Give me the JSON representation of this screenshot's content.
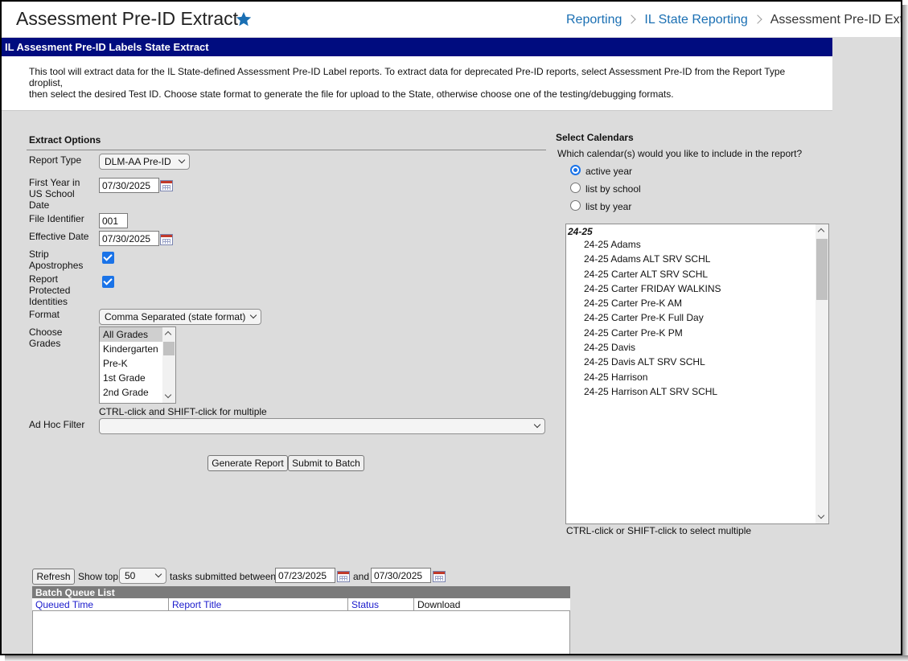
{
  "header": {
    "title": "Assessment Pre-ID Extract",
    "breadcrumb": [
      "Reporting",
      "IL State Reporting",
      "Assessment Pre-ID Extract"
    ]
  },
  "banner": {
    "title": "IL Assesment Pre-ID Labels State Extract"
  },
  "description": {
    "line1": "This tool will extract data for the IL State-defined Assessment Pre-ID Label reports. To extract data for deprecated Pre-ID reports, select Assessment Pre-ID from the Report Type droplist,",
    "line2": "then select the desired Test ID. Choose state format to generate the file for upload to the State, otherwise choose one of the testing/debugging formats."
  },
  "extract_options": {
    "title": "Extract Options",
    "report_type": {
      "label": "Report Type",
      "value": "DLM-AA Pre-ID"
    },
    "first_year": {
      "label": "First Year in US School Date",
      "value": "07/30/2025"
    },
    "file_identifier": {
      "label": "File Identifier",
      "value": "001"
    },
    "effective_date": {
      "label": "Effective Date",
      "value": "07/30/2025"
    },
    "strip_apostrophes": {
      "label": "Strip Apostrophes",
      "checked": true
    },
    "report_protected": {
      "label": "Report Protected Identities",
      "checked": true
    },
    "format": {
      "label": "Format",
      "value": "Comma Separated (state format)"
    },
    "grades": {
      "label": "Choose Grades",
      "items": [
        "All Grades",
        "Kindergarten",
        "Pre-K",
        "1st Grade",
        "2nd Grade"
      ],
      "selected": "All Grades",
      "hint": "CTRL-click and SHIFT-click for multiple"
    },
    "ad_hoc": {
      "label": "Ad Hoc Filter",
      "value": ""
    },
    "generate_label": "Generate Report",
    "submit_label": "Submit to Batch"
  },
  "calendars": {
    "title": "Select Calendars",
    "question": "Which calendar(s) would you like to include in the report?",
    "radios": [
      {
        "label": "active year",
        "checked": true
      },
      {
        "label": "list by school",
        "checked": false
      },
      {
        "label": "list by year",
        "checked": false
      }
    ],
    "group": "24-25",
    "items": [
      "24-25 Adams",
      "24-25 Adams ALT SRV SCHL",
      "24-25 Carter ALT SRV SCHL",
      "24-25 Carter FRIDAY WALKINS",
      "24-25 Carter Pre-K AM",
      "24-25 Carter Pre-K Full Day",
      "24-25 Carter Pre-K PM",
      "24-25 Davis",
      "24-25 Davis ALT SRV SCHL",
      "24-25 Harrison",
      "24-25 Harrison ALT SRV SCHL"
    ],
    "hint": "CTRL-click or SHIFT-click to select multiple"
  },
  "batch": {
    "refresh_label": "Refresh",
    "show_top_label": "Show top",
    "show_top_value": "50",
    "between_label": "tasks submitted between",
    "start_date": "07/23/2025",
    "and_label": "and",
    "end_date": "07/30/2025",
    "list_title": "Batch Queue List",
    "columns": [
      "Queued Time",
      "Report Title",
      "Status",
      "Download"
    ],
    "link_color": "#1a1acc"
  }
}
